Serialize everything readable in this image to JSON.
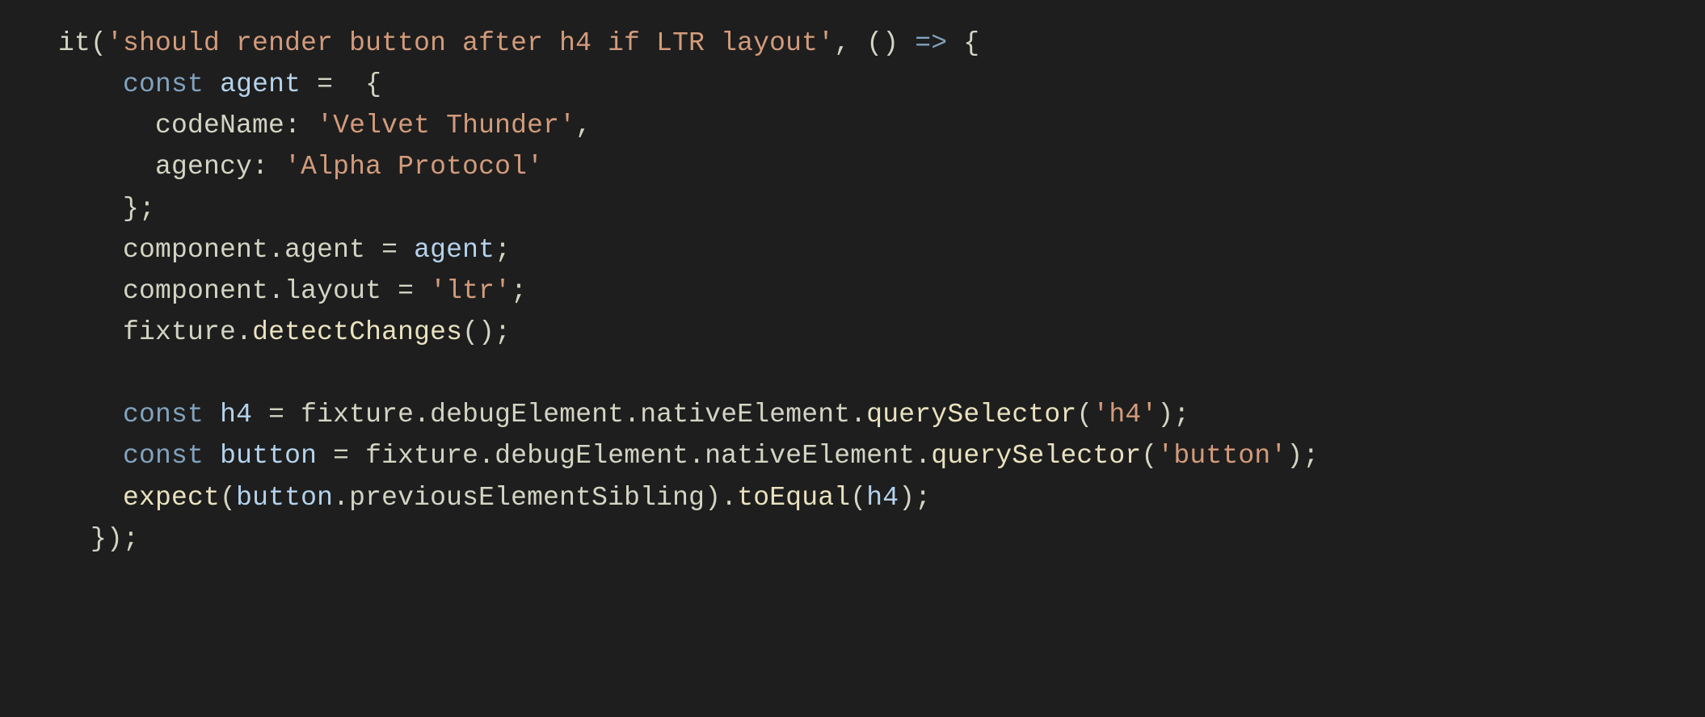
{
  "code": {
    "lines": [
      [
        {
          "cls": "tok-fn",
          "text": "it"
        },
        {
          "cls": "tok-punc",
          "text": "("
        },
        {
          "cls": "tok-str",
          "text": "'should render button after h4 if LTR layout'"
        },
        {
          "cls": "tok-punc",
          "text": ", () "
        },
        {
          "cls": "tok-arrow",
          "text": "=>"
        },
        {
          "cls": "tok-punc",
          "text": " {"
        }
      ],
      [
        {
          "cls": "tok-punc",
          "text": "    "
        },
        {
          "cls": "tok-kw",
          "text": "const"
        },
        {
          "cls": "tok-punc",
          "text": " "
        },
        {
          "cls": "tok-name",
          "text": "agent"
        },
        {
          "cls": "tok-punc",
          "text": " "
        },
        {
          "cls": "tok-op",
          "text": "="
        },
        {
          "cls": "tok-punc",
          "text": "  {"
        }
      ],
      [
        {
          "cls": "tok-punc",
          "text": "      "
        },
        {
          "cls": "tok-prop",
          "text": "codeName"
        },
        {
          "cls": "tok-punc",
          "text": ": "
        },
        {
          "cls": "tok-str",
          "text": "'Velvet Thunder'"
        },
        {
          "cls": "tok-punc",
          "text": ","
        }
      ],
      [
        {
          "cls": "tok-punc",
          "text": "      "
        },
        {
          "cls": "tok-prop",
          "text": "agency"
        },
        {
          "cls": "tok-punc",
          "text": ": "
        },
        {
          "cls": "tok-str",
          "text": "'Alpha Protocol'"
        }
      ],
      [
        {
          "cls": "tok-punc",
          "text": "    };"
        }
      ],
      [
        {
          "cls": "tok-punc",
          "text": "    "
        },
        {
          "cls": "tok-prop",
          "text": "component"
        },
        {
          "cls": "tok-punc",
          "text": "."
        },
        {
          "cls": "tok-prop",
          "text": "agent"
        },
        {
          "cls": "tok-punc",
          "text": " "
        },
        {
          "cls": "tok-op",
          "text": "="
        },
        {
          "cls": "tok-punc",
          "text": " "
        },
        {
          "cls": "tok-name",
          "text": "agent"
        },
        {
          "cls": "tok-punc",
          "text": ";"
        }
      ],
      [
        {
          "cls": "tok-punc",
          "text": "    "
        },
        {
          "cls": "tok-prop",
          "text": "component"
        },
        {
          "cls": "tok-punc",
          "text": "."
        },
        {
          "cls": "tok-prop",
          "text": "layout"
        },
        {
          "cls": "tok-punc",
          "text": " "
        },
        {
          "cls": "tok-op",
          "text": "="
        },
        {
          "cls": "tok-punc",
          "text": " "
        },
        {
          "cls": "tok-str",
          "text": "'ltr'"
        },
        {
          "cls": "tok-punc",
          "text": ";"
        }
      ],
      [
        {
          "cls": "tok-punc",
          "text": "    "
        },
        {
          "cls": "tok-prop",
          "text": "fixture"
        },
        {
          "cls": "tok-punc",
          "text": "."
        },
        {
          "cls": "tok-method",
          "text": "detectChanges"
        },
        {
          "cls": "tok-punc",
          "text": "();"
        }
      ],
      [
        {
          "cls": "tok-punc",
          "text": ""
        }
      ],
      [
        {
          "cls": "tok-punc",
          "text": "    "
        },
        {
          "cls": "tok-kw",
          "text": "const"
        },
        {
          "cls": "tok-punc",
          "text": " "
        },
        {
          "cls": "tok-name",
          "text": "h4"
        },
        {
          "cls": "tok-punc",
          "text": " "
        },
        {
          "cls": "tok-op",
          "text": "="
        },
        {
          "cls": "tok-punc",
          "text": " "
        },
        {
          "cls": "tok-prop",
          "text": "fixture"
        },
        {
          "cls": "tok-punc",
          "text": "."
        },
        {
          "cls": "tok-prop",
          "text": "debugElement"
        },
        {
          "cls": "tok-punc",
          "text": "."
        },
        {
          "cls": "tok-prop",
          "text": "nativeElement"
        },
        {
          "cls": "tok-punc",
          "text": "."
        },
        {
          "cls": "tok-method",
          "text": "querySelector"
        },
        {
          "cls": "tok-punc",
          "text": "("
        },
        {
          "cls": "tok-str",
          "text": "'h4'"
        },
        {
          "cls": "tok-punc",
          "text": ");"
        }
      ],
      [
        {
          "cls": "tok-punc",
          "text": "    "
        },
        {
          "cls": "tok-kw",
          "text": "const"
        },
        {
          "cls": "tok-punc",
          "text": " "
        },
        {
          "cls": "tok-name",
          "text": "button"
        },
        {
          "cls": "tok-punc",
          "text": " "
        },
        {
          "cls": "tok-op",
          "text": "="
        },
        {
          "cls": "tok-punc",
          "text": " "
        },
        {
          "cls": "tok-prop",
          "text": "fixture"
        },
        {
          "cls": "tok-punc",
          "text": "."
        },
        {
          "cls": "tok-prop",
          "text": "debugElement"
        },
        {
          "cls": "tok-punc",
          "text": "."
        },
        {
          "cls": "tok-prop",
          "text": "nativeElement"
        },
        {
          "cls": "tok-punc",
          "text": "."
        },
        {
          "cls": "tok-method",
          "text": "querySelector"
        },
        {
          "cls": "tok-punc",
          "text": "("
        },
        {
          "cls": "tok-str",
          "text": "'button'"
        },
        {
          "cls": "tok-punc",
          "text": ");"
        }
      ],
      [
        {
          "cls": "tok-punc",
          "text": "    "
        },
        {
          "cls": "tok-method",
          "text": "expect"
        },
        {
          "cls": "tok-punc",
          "text": "("
        },
        {
          "cls": "tok-name",
          "text": "button"
        },
        {
          "cls": "tok-punc",
          "text": "."
        },
        {
          "cls": "tok-prop",
          "text": "previousElementSibling"
        },
        {
          "cls": "tok-punc",
          "text": ")."
        },
        {
          "cls": "tok-method",
          "text": "toEqual"
        },
        {
          "cls": "tok-punc",
          "text": "("
        },
        {
          "cls": "tok-name",
          "text": "h4"
        },
        {
          "cls": "tok-punc",
          "text": ");"
        }
      ],
      [
        {
          "cls": "tok-punc",
          "text": "  });"
        }
      ]
    ]
  }
}
